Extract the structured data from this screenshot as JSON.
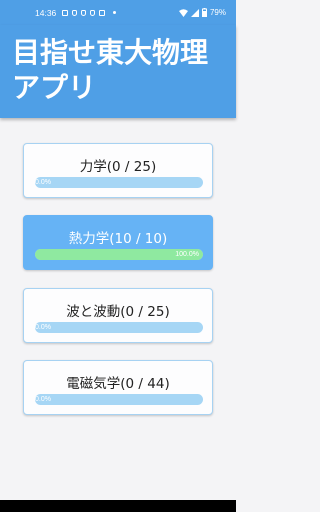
{
  "status_bar": {
    "time": "14:36",
    "battery": "79%"
  },
  "app": {
    "title": "目指せ東大物理アプリ"
  },
  "categories": [
    {
      "label": "力学(0 / 25)",
      "progress_fraction": 0.0,
      "progress_text": "0.0%"
    },
    {
      "label": "熱力学(10 / 10)",
      "progress_fraction": 1.0,
      "progress_text": "100.0%"
    },
    {
      "label": "波と波動(0 / 25)",
      "progress_fraction": 0.0,
      "progress_text": "0.0%"
    },
    {
      "label": "電磁気学(0 / 44)",
      "progress_fraction": 0.0,
      "progress_text": "0.0%"
    }
  ],
  "colors": {
    "primary": "#4f9fe6",
    "card_active": "#66b3f5",
    "progress_track": "#a6d6f5",
    "progress_fill": "#8fe9a0"
  }
}
